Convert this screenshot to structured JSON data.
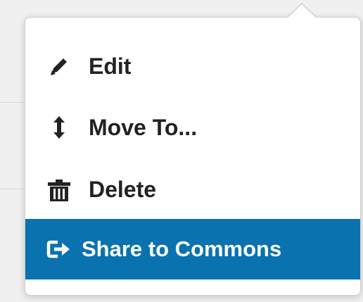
{
  "menu": {
    "items": [
      {
        "label": "Edit",
        "icon": "pencil-icon"
      },
      {
        "label": "Move To...",
        "icon": "up-down-arrow-icon"
      },
      {
        "label": "Delete",
        "icon": "trash-icon"
      },
      {
        "label": "Share to Commons",
        "icon": "share-arrow-icon",
        "highlighted": true
      }
    ]
  },
  "colors": {
    "highlight_bg": "#0a72ae",
    "highlight_text": "#ffffff",
    "item_text": "#222222",
    "page_bg": "#f0f0f0"
  }
}
